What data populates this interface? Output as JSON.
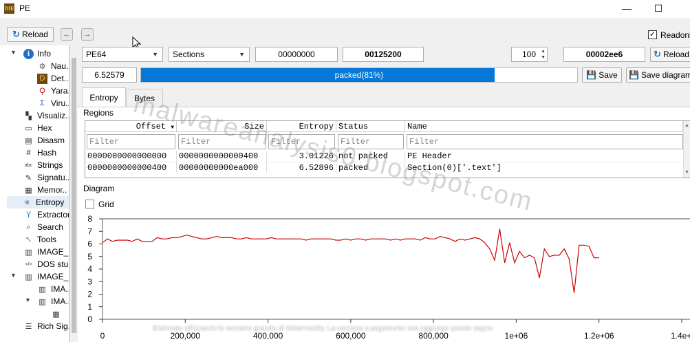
{
  "window": {
    "title": "PE",
    "minimize": "—",
    "maximize": "☐"
  },
  "toolbar": {
    "reload_label": "Reload",
    "readonly_label": "Readonl",
    "readonly_checked": "✓"
  },
  "sidebar": {
    "items": [
      {
        "label": "Info",
        "icon": "info-icon"
      },
      {
        "label": "Nau..",
        "icon": "nauz-icon"
      },
      {
        "label": "Det..",
        "icon": "detect-it-easy-icon"
      },
      {
        "label": "Yara..",
        "icon": "yara-icon"
      },
      {
        "label": "Viru..",
        "icon": "virustotal-icon"
      },
      {
        "label": "Visualiz..",
        "icon": "visualization-icon"
      },
      {
        "label": "Hex",
        "icon": "hex-icon"
      },
      {
        "label": "Disasm",
        "icon": "disasm-icon"
      },
      {
        "label": "Hash",
        "icon": "hash-icon"
      },
      {
        "label": "Strings",
        "icon": "strings-icon"
      },
      {
        "label": "Signatu..",
        "icon": "signatures-icon"
      },
      {
        "label": "Memor..",
        "icon": "memory-map-icon"
      },
      {
        "label": "Entropy",
        "icon": "entropy-icon"
      },
      {
        "label": "Extractor",
        "icon": "extractor-icon"
      },
      {
        "label": "Search",
        "icon": "search-icon"
      },
      {
        "label": "Tools",
        "icon": "tools-icon"
      },
      {
        "label": "IMAGE_..",
        "icon": "image-header-icon"
      },
      {
        "label": "DOS stub",
        "icon": "dos-stub-icon"
      },
      {
        "label": "IMAGE_..",
        "icon": "image-nt-headers-icon"
      },
      {
        "label": "IMA..",
        "icon": "image-file-header-icon"
      },
      {
        "label": "IMA..",
        "icon": "image-optional-header-icon"
      },
      {
        "label": "",
        "icon": "table-icon"
      },
      {
        "label": "Rich Sig..",
        "icon": "rich-signature-icon"
      }
    ]
  },
  "controls": {
    "type_select": "PE64",
    "region_select": "Sections",
    "offset": "00000000",
    "size": "00125200",
    "block_count": "100",
    "block_size": "00002ee6",
    "reload_label": "Reload",
    "entropy_value": "6.52579",
    "progress_text": "packed(81%)",
    "progress_percent": 81,
    "save_label": "Save",
    "save_diagram_label": "Save diagram"
  },
  "tabs": [
    {
      "label": "Entropy"
    },
    {
      "label": "Bytes"
    }
  ],
  "regions": {
    "label": "Regions",
    "columns": [
      "Offset",
      "Size",
      "Entropy",
      "Status",
      "Name"
    ],
    "filter_placeholder": "Filter",
    "rows": [
      {
        "offset": "0000000000000000",
        "size": "0000000000000400",
        "entropy": "3.01226",
        "status": "not packed",
        "name": "PE Header"
      },
      {
        "offset": "0000000000000400",
        "size": "00000000000ea000",
        "entropy": "6.52896",
        "status": "packed",
        "name": "Section(0)['.text']"
      }
    ]
  },
  "diagram": {
    "label": "Diagram",
    "grid_label": "Grid"
  },
  "chart_data": {
    "type": "line",
    "title": "",
    "xlabel": "",
    "ylabel": "",
    "xlim": [
      0,
      1420000
    ],
    "ylim": [
      0,
      8
    ],
    "x_ticks": [
      "0",
      "200,000",
      "400,000",
      "600,000",
      "800,000",
      "1e+06",
      "1.2e+06",
      "1.4e+0"
    ],
    "y_ticks": [
      "0",
      "1",
      "2",
      "3",
      "4",
      "5",
      "6",
      "7",
      "8"
    ],
    "grid": false,
    "color": "#cc0000",
    "series": [
      {
        "x": [
          0,
          12000,
          24000,
          36000,
          48000,
          60000,
          72000,
          84000,
          96000,
          108000,
          120000,
          132000,
          144000,
          156000,
          168000,
          180000,
          192000,
          204000,
          216000,
          228000,
          240000,
          252000,
          264000,
          276000,
          288000,
          300000,
          312000,
          324000,
          336000,
          348000,
          360000,
          372000,
          384000,
          396000,
          408000,
          420000,
          432000,
          444000,
          456000,
          468000,
          480000,
          492000,
          504000,
          516000,
          528000,
          540000,
          552000,
          564000,
          576000,
          588000,
          600000,
          612000,
          624000,
          636000,
          648000,
          660000,
          672000,
          684000,
          696000,
          708000,
          720000,
          732000,
          744000,
          756000,
          768000,
          780000,
          792000,
          804000,
          816000,
          828000,
          840000,
          852000,
          864000,
          876000,
          888000,
          900000,
          912000,
          924000,
          936000,
          948000,
          960000,
          972000,
          984000,
          996000,
          1008000,
          1020000,
          1032000,
          1044000,
          1056000,
          1068000,
          1080000,
          1092000,
          1104000,
          1116000,
          1128000,
          1140000,
          1152000,
          1164000,
          1176000,
          1188000,
          1200000
        ],
        "y": [
          6.1,
          6.4,
          6.2,
          6.3,
          6.3,
          6.3,
          6.2,
          6.4,
          6.2,
          6.2,
          6.2,
          6.5,
          6.4,
          6.4,
          6.5,
          6.5,
          6.6,
          6.7,
          6.6,
          6.5,
          6.4,
          6.4,
          6.5,
          6.6,
          6.5,
          6.5,
          6.5,
          6.4,
          6.4,
          6.5,
          6.4,
          6.4,
          6.4,
          6.4,
          6.5,
          6.4,
          6.4,
          6.4,
          6.4,
          6.4,
          6.4,
          6.3,
          6.4,
          6.4,
          6.4,
          6.4,
          6.4,
          6.3,
          6.3,
          6.4,
          6.3,
          6.4,
          6.4,
          6.3,
          6.4,
          6.4,
          6.4,
          6.4,
          6.3,
          6.4,
          6.3,
          6.4,
          6.4,
          6.4,
          6.3,
          6.5,
          6.4,
          6.4,
          6.6,
          6.5,
          6.4,
          6.2,
          6.4,
          6.3,
          6.4,
          6.5,
          6.4,
          6.1,
          5.6,
          4.7,
          7.2,
          4.5,
          6.1,
          4.5,
          5.4,
          4.9,
          5.1,
          4.9,
          3.3,
          5.6,
          5.0,
          5.1,
          5.1,
          5.6,
          4.8,
          2.1,
          5.9,
          5.9,
          5.8,
          4.9,
          4.9
        ]
      }
    ]
  },
  "watermark": "malwareanalysis0.blogspot.com",
  "footer_note": "Elaborato utilizzando la versione gratuita di Watermarkly. La versione a pagamento non aggiunge questo segno."
}
